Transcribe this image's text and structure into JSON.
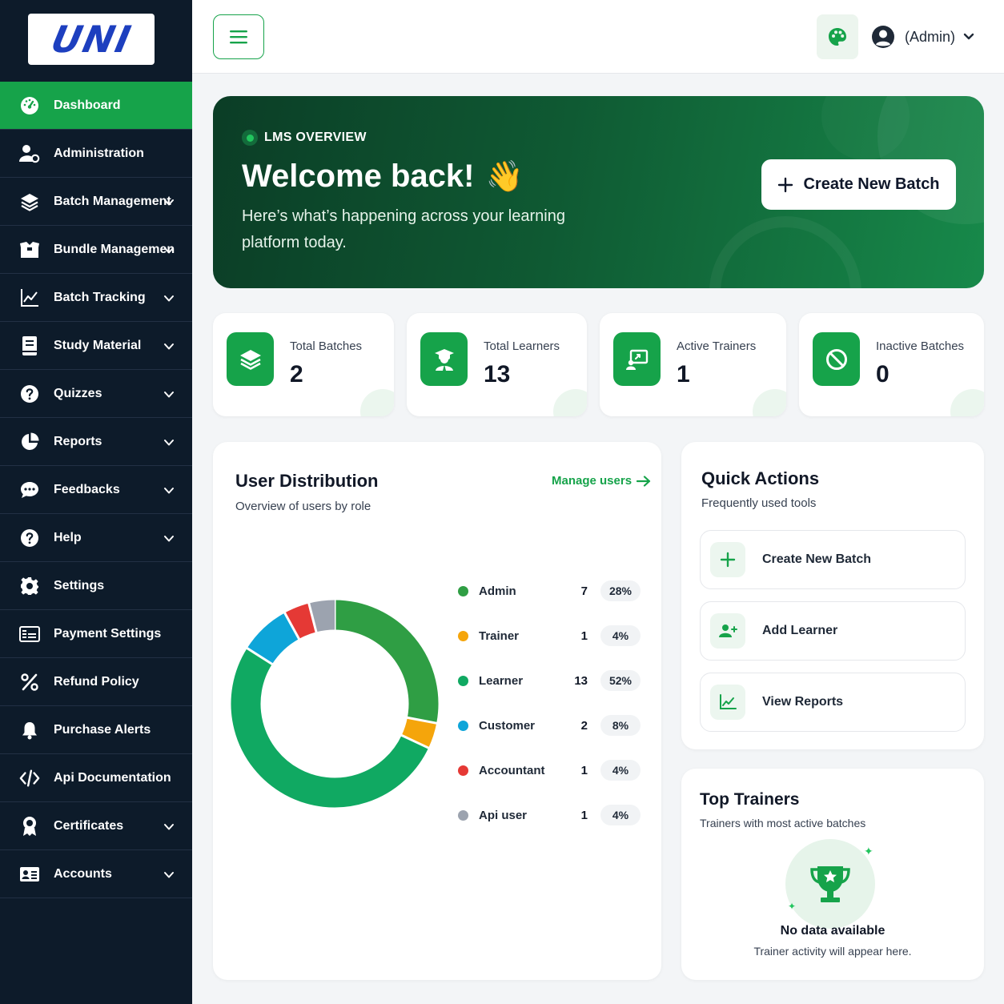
{
  "logo": {
    "text": "UNI"
  },
  "sidebar": {
    "items": [
      {
        "label": "Dashboard",
        "icon": "dashboard-icon",
        "has_chevron": false
      },
      {
        "label": "Administration",
        "icon": "user-gear-icon",
        "has_chevron": false
      },
      {
        "label": "Batch Management",
        "icon": "layers-icon",
        "has_chevron": true
      },
      {
        "label": "Bundle Managemen",
        "icon": "box-icon",
        "has_chevron": true
      },
      {
        "label": "Batch Tracking",
        "icon": "line-chart-icon",
        "has_chevron": true
      },
      {
        "label": "Study Material",
        "icon": "book-icon",
        "has_chevron": true
      },
      {
        "label": "Quizzes",
        "icon": "question-icon",
        "has_chevron": true
      },
      {
        "label": "Reports",
        "icon": "pie-chart-icon",
        "has_chevron": true
      },
      {
        "label": "Feedbacks",
        "icon": "chat-icon",
        "has_chevron": true
      },
      {
        "label": "Help",
        "icon": "help-icon",
        "has_chevron": true
      },
      {
        "label": "Settings",
        "icon": "gear-icon",
        "has_chevron": false
      },
      {
        "label": "Payment Settings",
        "icon": "card-icon",
        "has_chevron": false
      },
      {
        "label": "Refund Policy",
        "icon": "percent-icon",
        "has_chevron": false
      },
      {
        "label": "Purchase Alerts",
        "icon": "bell-icon",
        "has_chevron": false
      },
      {
        "label": "Api Documentation",
        "icon": "code-icon",
        "has_chevron": false
      },
      {
        "label": "Certificates",
        "icon": "award-icon",
        "has_chevron": true
      },
      {
        "label": "Accounts",
        "icon": "id-card-icon",
        "has_chevron": true
      }
    ]
  },
  "topbar": {
    "user_label": "(Admin)"
  },
  "hero": {
    "tag": "LMS OVERVIEW",
    "title": "Welcome back!",
    "emoji": "👋",
    "subtitle": "Here’s what’s happening across your learning platform today.",
    "button_label": "Create New Batch"
  },
  "stats": [
    {
      "label": "Total Batches",
      "value": "2",
      "icon": "layers-icon"
    },
    {
      "label": "Total Learners",
      "value": "13",
      "icon": "graduate-icon"
    },
    {
      "label": "Active Trainers",
      "value": "1",
      "icon": "presentation-icon"
    },
    {
      "label": "Inactive Batches",
      "value": "0",
      "icon": "ban-icon"
    }
  ],
  "user_distribution": {
    "title": "User Distribution",
    "subtitle": "Overview of users by role",
    "link_label": "Manage users",
    "roles": [
      {
        "name": "Admin",
        "count": "7",
        "percent": "28%",
        "color": "#2f9e44"
      },
      {
        "name": "Trainer",
        "count": "1",
        "percent": "4%",
        "color": "#f5a50b"
      },
      {
        "name": "Learner",
        "count": "13",
        "percent": "52%",
        "color": "#10a962"
      },
      {
        "name": "Customer",
        "count": "2",
        "percent": "8%",
        "color": "#0ea5d9"
      },
      {
        "name": "Accountant",
        "count": "1",
        "percent": "4%",
        "color": "#e53935"
      },
      {
        "name": "Api user",
        "count": "1",
        "percent": "4%",
        "color": "#9ca3af"
      }
    ]
  },
  "chart_data": {
    "type": "pie",
    "categories": [
      "Admin",
      "Trainer",
      "Learner",
      "Customer",
      "Accountant",
      "Api user"
    ],
    "values": [
      7,
      1,
      13,
      2,
      1,
      1
    ],
    "colors": [
      "#2f9e44",
      "#f5a50b",
      "#10a962",
      "#0ea5d9",
      "#e53935",
      "#9ca3af"
    ],
    "donut": true,
    "title": "User Distribution",
    "legend": "right"
  },
  "quick_actions": {
    "title": "Quick Actions",
    "subtitle": "Frequently used tools",
    "items": [
      {
        "label": "Create New Batch",
        "icon": "plus-icon"
      },
      {
        "label": "Add Learner",
        "icon": "user-plus-icon"
      },
      {
        "label": "View Reports",
        "icon": "line-chart-icon"
      }
    ]
  },
  "top_trainers": {
    "title": "Top Trainers",
    "subtitle": "Trainers with most active batches",
    "empty_title": "No data available",
    "empty_subtitle": "Trainer activity will appear here."
  },
  "colors": {
    "sidebar_bg": "#0d1b2a",
    "accent": "#16a34a"
  }
}
